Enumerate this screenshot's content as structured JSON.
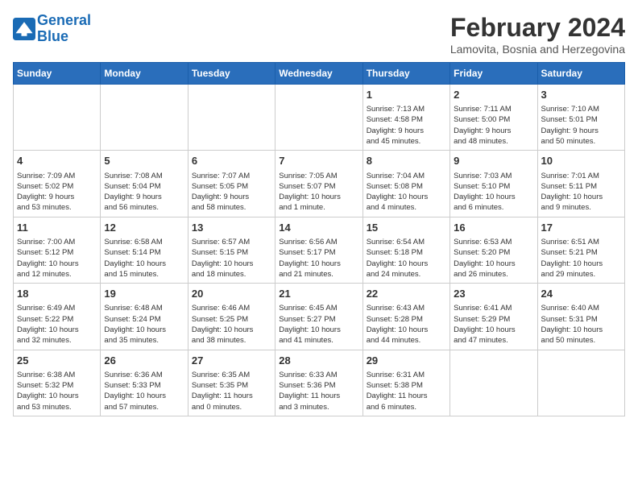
{
  "header": {
    "logo_line1": "General",
    "logo_line2": "Blue",
    "month": "February 2024",
    "location": "Lamovita, Bosnia and Herzegovina"
  },
  "weekdays": [
    "Sunday",
    "Monday",
    "Tuesday",
    "Wednesday",
    "Thursday",
    "Friday",
    "Saturday"
  ],
  "weeks": [
    [
      {
        "day": "",
        "info": ""
      },
      {
        "day": "",
        "info": ""
      },
      {
        "day": "",
        "info": ""
      },
      {
        "day": "",
        "info": ""
      },
      {
        "day": "1",
        "info": "Sunrise: 7:13 AM\nSunset: 4:58 PM\nDaylight: 9 hours\nand 45 minutes."
      },
      {
        "day": "2",
        "info": "Sunrise: 7:11 AM\nSunset: 5:00 PM\nDaylight: 9 hours\nand 48 minutes."
      },
      {
        "day": "3",
        "info": "Sunrise: 7:10 AM\nSunset: 5:01 PM\nDaylight: 9 hours\nand 50 minutes."
      }
    ],
    [
      {
        "day": "4",
        "info": "Sunrise: 7:09 AM\nSunset: 5:02 PM\nDaylight: 9 hours\nand 53 minutes."
      },
      {
        "day": "5",
        "info": "Sunrise: 7:08 AM\nSunset: 5:04 PM\nDaylight: 9 hours\nand 56 minutes."
      },
      {
        "day": "6",
        "info": "Sunrise: 7:07 AM\nSunset: 5:05 PM\nDaylight: 9 hours\nand 58 minutes."
      },
      {
        "day": "7",
        "info": "Sunrise: 7:05 AM\nSunset: 5:07 PM\nDaylight: 10 hours\nand 1 minute."
      },
      {
        "day": "8",
        "info": "Sunrise: 7:04 AM\nSunset: 5:08 PM\nDaylight: 10 hours\nand 4 minutes."
      },
      {
        "day": "9",
        "info": "Sunrise: 7:03 AM\nSunset: 5:10 PM\nDaylight: 10 hours\nand 6 minutes."
      },
      {
        "day": "10",
        "info": "Sunrise: 7:01 AM\nSunset: 5:11 PM\nDaylight: 10 hours\nand 9 minutes."
      }
    ],
    [
      {
        "day": "11",
        "info": "Sunrise: 7:00 AM\nSunset: 5:12 PM\nDaylight: 10 hours\nand 12 minutes."
      },
      {
        "day": "12",
        "info": "Sunrise: 6:58 AM\nSunset: 5:14 PM\nDaylight: 10 hours\nand 15 minutes."
      },
      {
        "day": "13",
        "info": "Sunrise: 6:57 AM\nSunset: 5:15 PM\nDaylight: 10 hours\nand 18 minutes."
      },
      {
        "day": "14",
        "info": "Sunrise: 6:56 AM\nSunset: 5:17 PM\nDaylight: 10 hours\nand 21 minutes."
      },
      {
        "day": "15",
        "info": "Sunrise: 6:54 AM\nSunset: 5:18 PM\nDaylight: 10 hours\nand 24 minutes."
      },
      {
        "day": "16",
        "info": "Sunrise: 6:53 AM\nSunset: 5:20 PM\nDaylight: 10 hours\nand 26 minutes."
      },
      {
        "day": "17",
        "info": "Sunrise: 6:51 AM\nSunset: 5:21 PM\nDaylight: 10 hours\nand 29 minutes."
      }
    ],
    [
      {
        "day": "18",
        "info": "Sunrise: 6:49 AM\nSunset: 5:22 PM\nDaylight: 10 hours\nand 32 minutes."
      },
      {
        "day": "19",
        "info": "Sunrise: 6:48 AM\nSunset: 5:24 PM\nDaylight: 10 hours\nand 35 minutes."
      },
      {
        "day": "20",
        "info": "Sunrise: 6:46 AM\nSunset: 5:25 PM\nDaylight: 10 hours\nand 38 minutes."
      },
      {
        "day": "21",
        "info": "Sunrise: 6:45 AM\nSunset: 5:27 PM\nDaylight: 10 hours\nand 41 minutes."
      },
      {
        "day": "22",
        "info": "Sunrise: 6:43 AM\nSunset: 5:28 PM\nDaylight: 10 hours\nand 44 minutes."
      },
      {
        "day": "23",
        "info": "Sunrise: 6:41 AM\nSunset: 5:29 PM\nDaylight: 10 hours\nand 47 minutes."
      },
      {
        "day": "24",
        "info": "Sunrise: 6:40 AM\nSunset: 5:31 PM\nDaylight: 10 hours\nand 50 minutes."
      }
    ],
    [
      {
        "day": "25",
        "info": "Sunrise: 6:38 AM\nSunset: 5:32 PM\nDaylight: 10 hours\nand 53 minutes."
      },
      {
        "day": "26",
        "info": "Sunrise: 6:36 AM\nSunset: 5:33 PM\nDaylight: 10 hours\nand 57 minutes."
      },
      {
        "day": "27",
        "info": "Sunrise: 6:35 AM\nSunset: 5:35 PM\nDaylight: 11 hours\nand 0 minutes."
      },
      {
        "day": "28",
        "info": "Sunrise: 6:33 AM\nSunset: 5:36 PM\nDaylight: 11 hours\nand 3 minutes."
      },
      {
        "day": "29",
        "info": "Sunrise: 6:31 AM\nSunset: 5:38 PM\nDaylight: 11 hours\nand 6 minutes."
      },
      {
        "day": "",
        "info": ""
      },
      {
        "day": "",
        "info": ""
      }
    ]
  ]
}
